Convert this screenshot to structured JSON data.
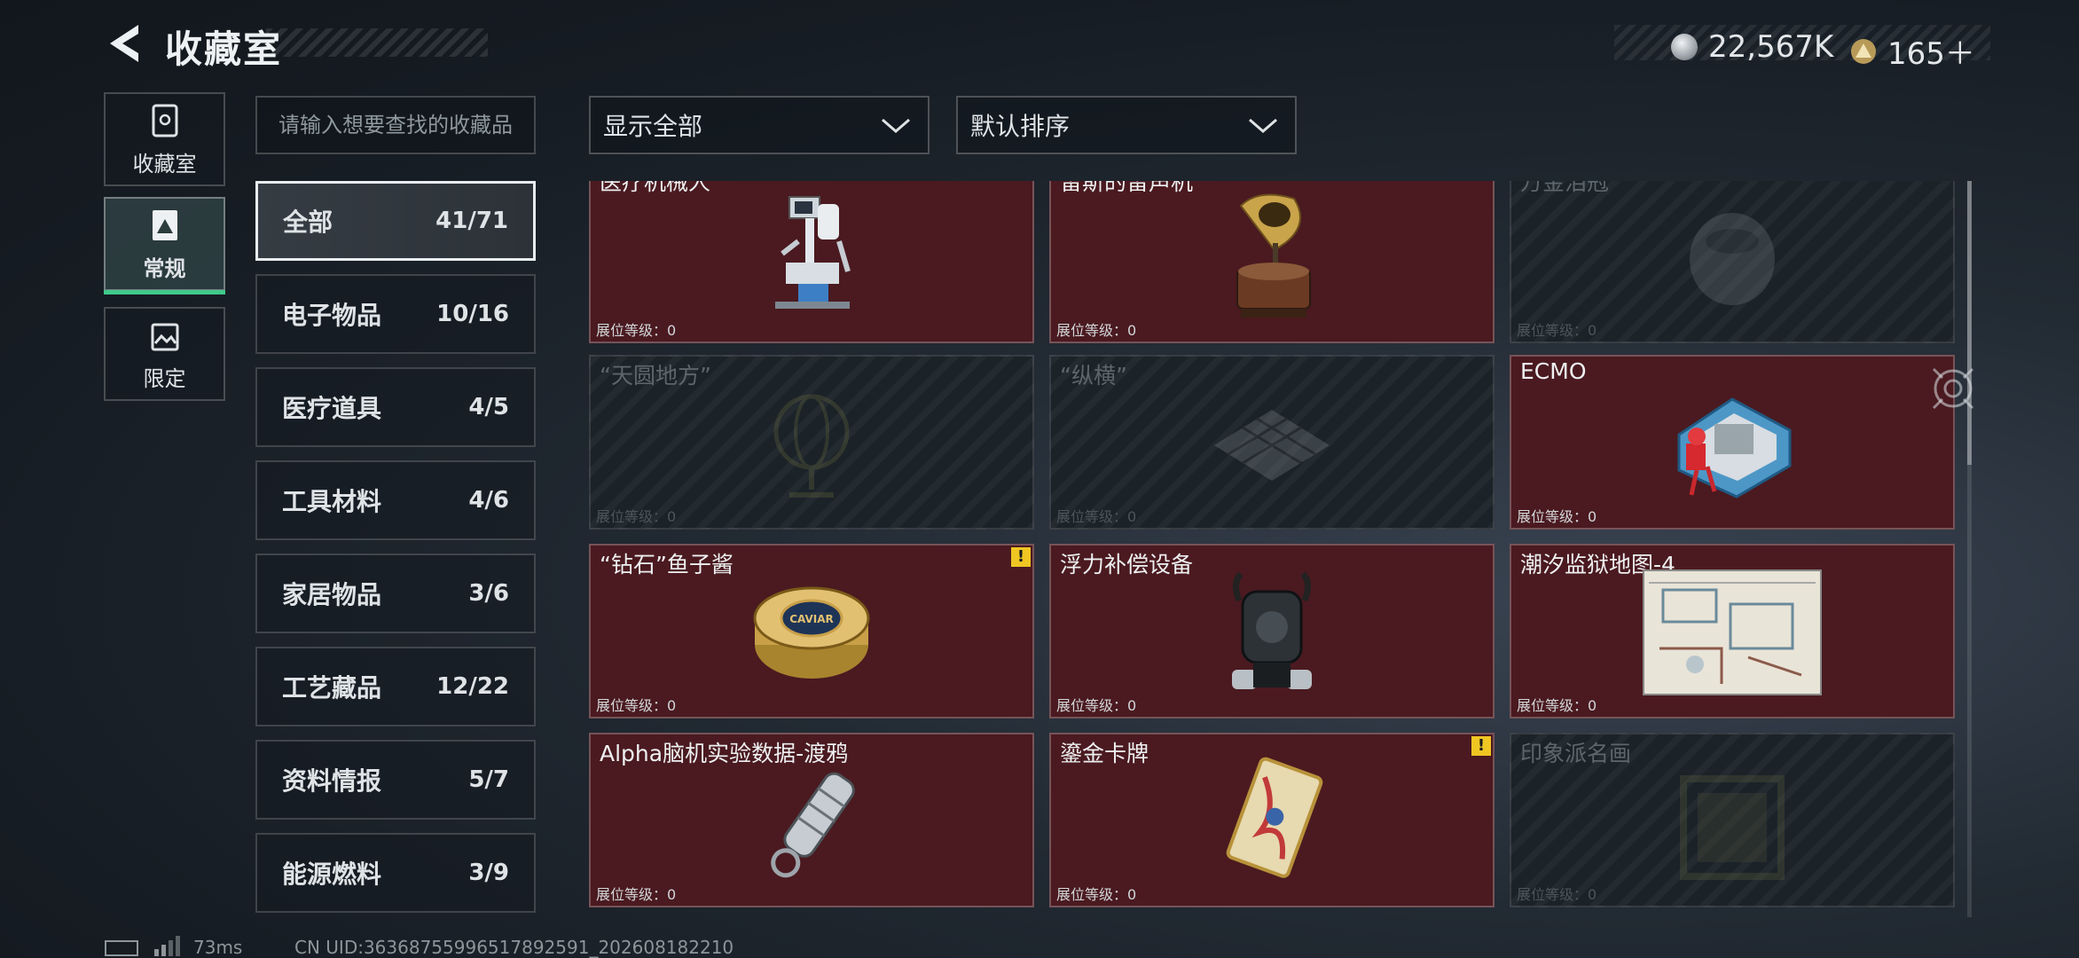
{
  "header": {
    "title": "收藏室"
  },
  "currencies": [
    {
      "icon": "silver-coin-icon",
      "value": "22,567K"
    },
    {
      "icon": "gold-triangle-coin-icon",
      "value": "165＋"
    }
  ],
  "left_nav": [
    {
      "label": "收藏室",
      "icon": "cabinet-icon",
      "active": false
    },
    {
      "label": "常规",
      "icon": "framed-picture-icon",
      "active": true
    },
    {
      "label": "限定",
      "icon": "landscape-icon",
      "active": false
    }
  ],
  "search": {
    "placeholder": "请输入想要查找的收藏品"
  },
  "filters": {
    "show": "显示全部",
    "sort": "默认排序"
  },
  "categories": [
    {
      "label": "全部",
      "count": "41/71",
      "active": true
    },
    {
      "label": "电子物品",
      "count": "10/16"
    },
    {
      "label": "医疗道具",
      "count": "4/5"
    },
    {
      "label": "工具材料",
      "count": "4/6"
    },
    {
      "label": "家居物品",
      "count": "3/6"
    },
    {
      "label": "工艺藏品",
      "count": "12/22"
    },
    {
      "label": "资料情报",
      "count": "5/7"
    },
    {
      "label": "能源燃料",
      "count": "3/9"
    }
  ],
  "level_label": "展位等级：0",
  "items": [
    {
      "name": "医疗机械人",
      "state": "unlocked",
      "art": "medical-robot",
      "alert": false
    },
    {
      "name": "留斯的留声机",
      "state": "unlocked",
      "art": "gramophone",
      "alert": false
    },
    {
      "name": "万金泪冠",
      "state": "locked",
      "art": "crown",
      "alert": false
    },
    {
      "name": "“天圆地方”",
      "state": "locked",
      "art": "globe",
      "alert": false
    },
    {
      "name": "“纵横”",
      "state": "locked",
      "art": "chessboard",
      "alert": false
    },
    {
      "name": "ECMO",
      "state": "unlocked",
      "art": "ecmo",
      "alert": false
    },
    {
      "name": "“钻石”鱼子酱",
      "state": "unlocked",
      "art": "caviar",
      "alert": true,
      "caviar_text": "CAVIAR"
    },
    {
      "name": "浮力补偿设备",
      "state": "unlocked",
      "art": "bcd",
      "alert": false
    },
    {
      "name": "潮汐监狱地图-4",
      "state": "unlocked",
      "art": "map",
      "alert": false
    },
    {
      "name": "Alpha脑机实验数据-渡鸦",
      "state": "unlocked",
      "art": "capsule",
      "alert": false
    },
    {
      "name": "鎏金卡牌",
      "state": "unlocked",
      "art": "card",
      "alert": true
    },
    {
      "name": "印象派名画",
      "state": "locked",
      "art": "painting",
      "alert": false
    }
  ],
  "status": {
    "ping": "73ms",
    "uid": "CN UID:3636875599651789259​1_202608182210"
  }
}
